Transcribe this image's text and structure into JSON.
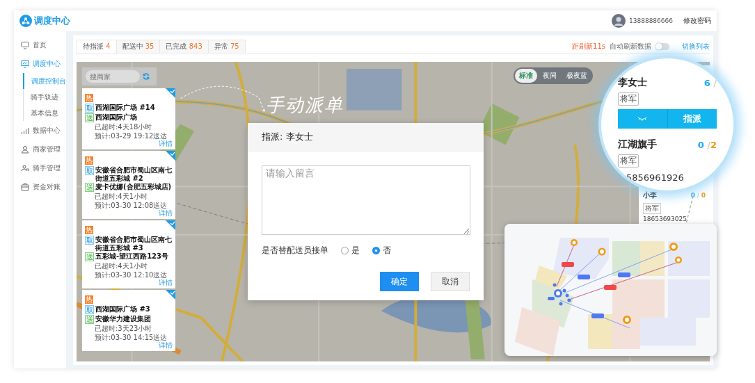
{
  "header": {
    "logo": "调度中心",
    "phone": "13888886666",
    "change_password": "修改密码"
  },
  "sidebar": {
    "items": [
      {
        "label": "首页",
        "selected": false
      },
      {
        "label": "调度中心",
        "selected": true,
        "expanded": true,
        "children": [
          {
            "label": "调度控制台",
            "selected": true
          },
          {
            "label": "骑手轨迹",
            "selected": false
          },
          {
            "label": "基本信息",
            "selected": false
          }
        ]
      },
      {
        "label": "数据中心",
        "selected": false
      },
      {
        "label": "商家管理",
        "selected": false
      },
      {
        "label": "骑手管理",
        "selected": false
      },
      {
        "label": "资金对账",
        "selected": false
      }
    ]
  },
  "tabs": [
    {
      "label": "待指派",
      "count": "4",
      "selected": true
    },
    {
      "label": "配送中",
      "count": "35",
      "selected": false
    },
    {
      "label": "已完成",
      "count": "843",
      "selected": false
    },
    {
      "label": "异常",
      "count": "75",
      "selected": false
    }
  ],
  "toolbar": {
    "countdown": "距刷新11s",
    "auto_refresh_label": "自动刷新数据",
    "auto_refresh_on": false,
    "switch_view": "切换列表"
  },
  "map": {
    "search_placeholder": "搜商家",
    "layers": [
      {
        "label": "标准",
        "selected": true
      },
      {
        "label": "夜间",
        "selected": false
      },
      {
        "label": "极夜蓝",
        "selected": false
      }
    ]
  },
  "orders": [
    {
      "tag": "热",
      "pickup_mark": "取",
      "pickup": "西湖国际广场 #14",
      "dropoff_mark": "送",
      "dropoff": "西湖国际广场",
      "overdue": "已超时:4天18小时",
      "eta": "预计:03-29 19:12送达",
      "detail": "详情",
      "checked": true
    },
    {
      "tag": "热",
      "pickup_mark": "取",
      "pickup": "安徽省合肥市蜀山区南七街道五彩城 #2",
      "dropoff_mark": "送",
      "dropoff": "麦卡优娜(合肥五彩城店)",
      "overdue": "已超时:4天1小时",
      "eta": "预计:03-30 12:08送达",
      "detail": "详情",
      "checked": true
    },
    {
      "tag": "热",
      "pickup_mark": "取",
      "pickup": "安徽省合肥市蜀山区南七街道五彩城 #3",
      "dropoff_mark": "送",
      "dropoff": "五彩城-望江西路123号",
      "overdue": "已超时:4天1小时",
      "eta": "预计:03-30 12:10送达",
      "detail": "详情",
      "checked": true
    },
    {
      "tag": "热",
      "pickup_mark": "取",
      "pickup": "西湖国际广场 #3",
      "dropoff_mark": "送",
      "dropoff": "安徽华力建设集团",
      "overdue": "已超时:3天23小时",
      "eta": "预计:03-30 14:15送达",
      "detail": "详情",
      "checked": true
    }
  ],
  "rider_panel": {
    "riders": [
      {
        "name": "小李",
        "done": "0",
        "separator": "/",
        "total": "0",
        "rank": "将军",
        "phone": "18653693025"
      }
    ]
  },
  "annotation": "手动派单",
  "dialog": {
    "title": "指派: 李女士",
    "placeholder": "请输入留言",
    "question": "是否替配送员接单",
    "options": [
      {
        "label": "是",
        "selected": false
      },
      {
        "label": "否",
        "selected": true
      }
    ],
    "buttons": [
      {
        "label": "确定",
        "kind": "primary"
      },
      {
        "label": "取消",
        "kind": "default"
      }
    ]
  },
  "magnifier": {
    "riders": [
      {
        "name": "李女士",
        "done": "6",
        "separator": "/",
        "rank": "将军",
        "action": "指派"
      },
      {
        "name": "江湖旗手",
        "done": "0",
        "separator": "/",
        "total": "2",
        "rank": "将军",
        "phone": "5856961926"
      }
    ]
  }
}
